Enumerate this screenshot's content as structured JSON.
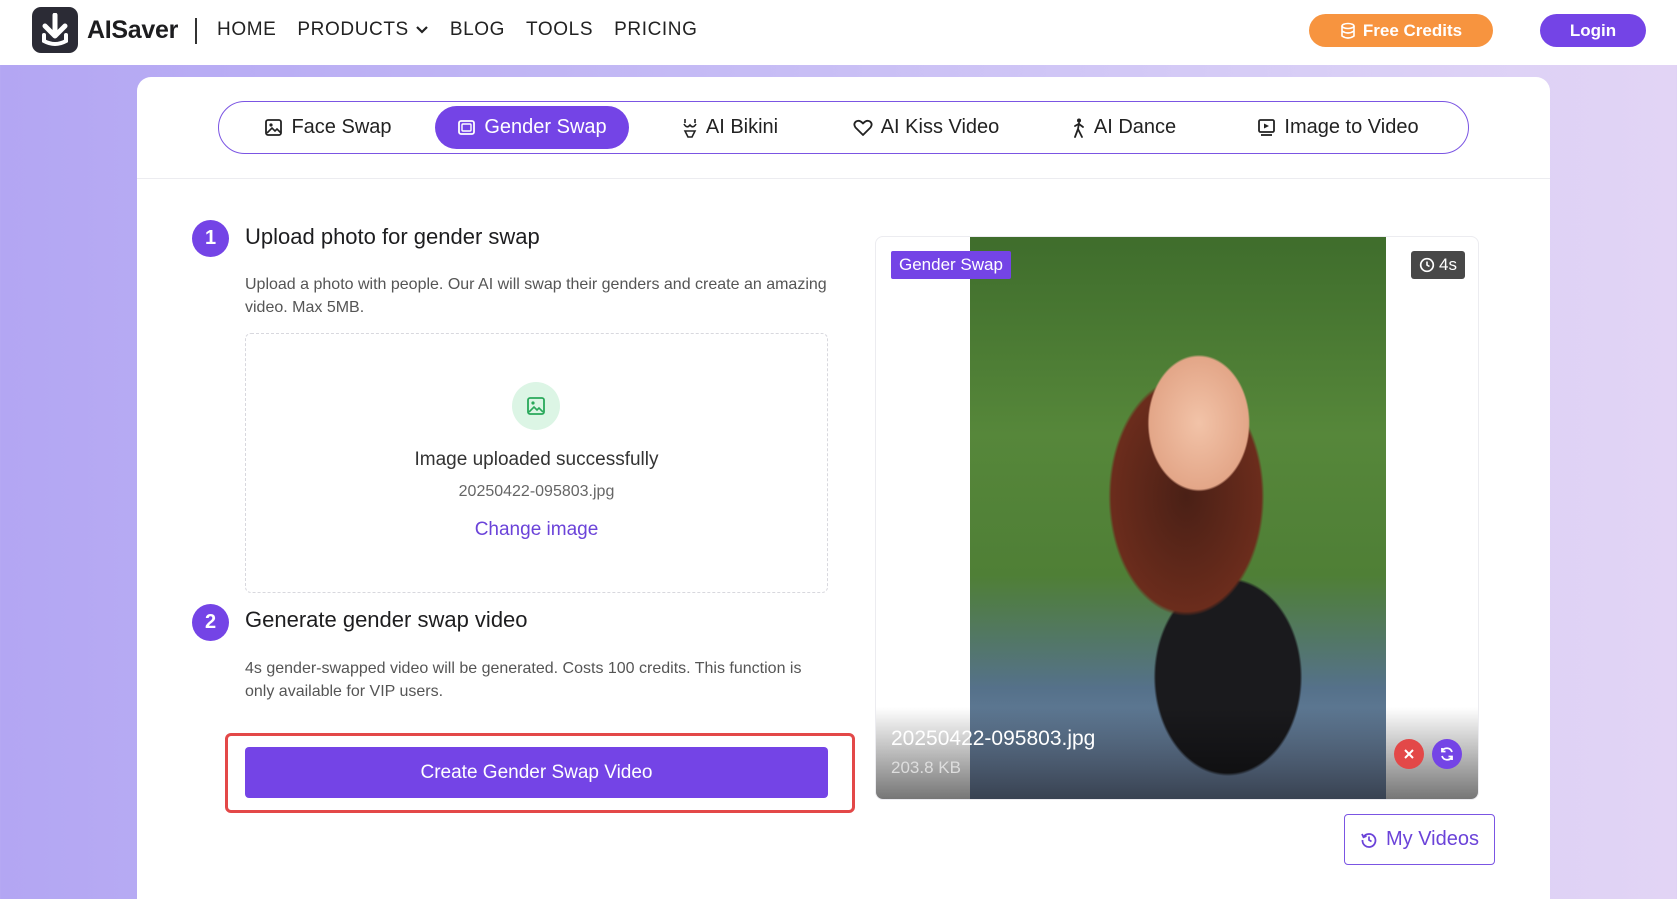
{
  "header": {
    "brand": "AISaver",
    "nav": [
      {
        "label": "HOME"
      },
      {
        "label": "PRODUCTS"
      },
      {
        "label": "BLOG"
      },
      {
        "label": "TOOLS"
      },
      {
        "label": "PRICING"
      }
    ],
    "free_credits_label": "Free Credits",
    "login_label": "Login"
  },
  "tabs": [
    {
      "label": "Face Swap",
      "icon": "image-icon",
      "active": false
    },
    {
      "label": "Gender Swap",
      "icon": "portrait-icon",
      "active": true
    },
    {
      "label": "AI Bikini",
      "icon": "bikini-icon",
      "active": false
    },
    {
      "label": "AI Kiss Video",
      "icon": "heart-icon",
      "active": false
    },
    {
      "label": "AI Dance",
      "icon": "dance-icon",
      "active": false
    },
    {
      "label": "Image to Video",
      "icon": "video-icon",
      "active": false
    }
  ],
  "step1": {
    "number": "1",
    "title": "Upload photo for gender swap",
    "description": "Upload a photo with people. Our AI will swap their genders and create an amazing video. Max 5MB.",
    "upload_status": "Image uploaded successfully",
    "file_name": "20250422-095803.jpg",
    "change_label": "Change image"
  },
  "step2": {
    "number": "2",
    "title": "Generate gender swap video",
    "description": "4s gender-swapped video will be generated. Costs 100 credits. This function is only available for VIP users.",
    "create_label": "Create Gender Swap Video"
  },
  "preview": {
    "badge": "Gender Swap",
    "duration": "4s",
    "file_name": "20250422-095803.jpg",
    "file_size": "203.8 KB"
  },
  "my_videos_label": "My Videos",
  "colors": {
    "accent": "#7444e6",
    "credits": "#f7943f",
    "highlight": "#e34848"
  }
}
